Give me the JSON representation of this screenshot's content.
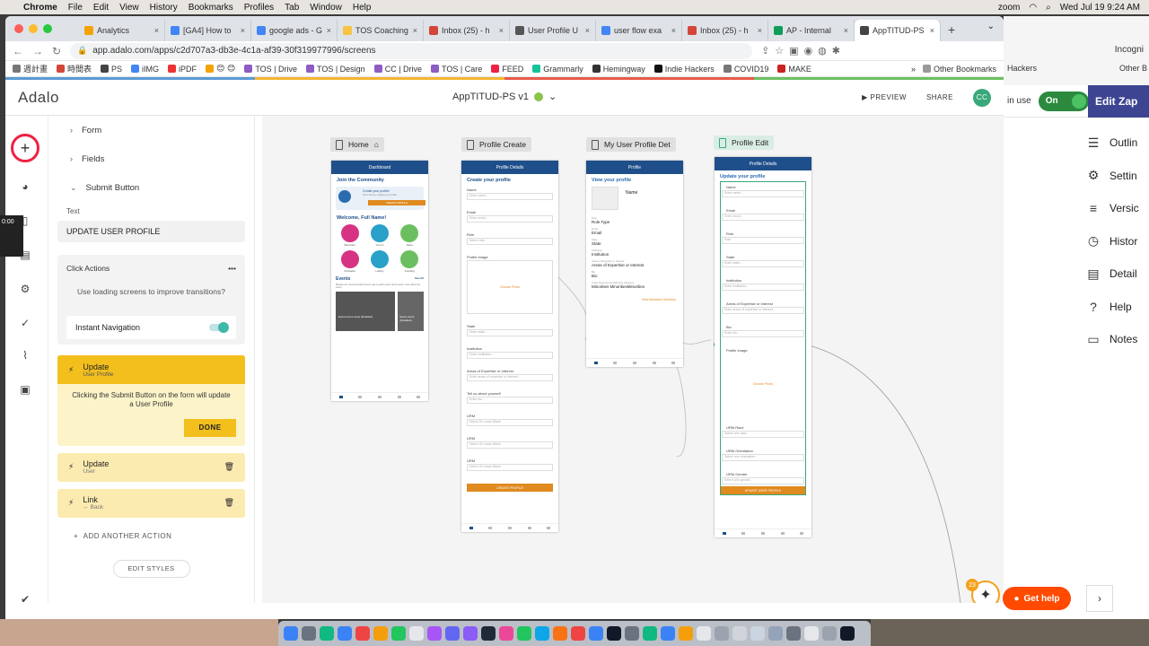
{
  "mac_menu": {
    "app": "Chrome",
    "items": [
      "File",
      "Edit",
      "View",
      "History",
      "Bookmarks",
      "Profiles",
      "Tab",
      "Window",
      "Help"
    ],
    "status_zoom": "zoom",
    "datetime": "Wed Jul 19  9:24 AM"
  },
  "browser": {
    "tabs": [
      {
        "title": "Analytics",
        "color": "#f4a300"
      },
      {
        "title": "[GA4] How to",
        "color": "#4285f4"
      },
      {
        "title": "google ads - G",
        "color": "#4285f4"
      },
      {
        "title": "TOS Coaching",
        "color": "#f6c342"
      },
      {
        "title": "Inbox (25) - h",
        "color": "#d44638"
      },
      {
        "title": "User Profile U",
        "color": "#555555"
      },
      {
        "title": "user flow exa",
        "color": "#4285f4"
      },
      {
        "title": "Inbox (25) - h",
        "color": "#d44638"
      },
      {
        "title": "AP - Internal",
        "color": "#0f9d58"
      },
      {
        "title": "AppTITUD-PS",
        "color": "#444444",
        "active": true
      }
    ],
    "url": "app.adalo.com/apps/c2d707a3-db3e-4c1a-af39-30f319977996/screens",
    "bookmarks": [
      "週計畫",
      "時間表",
      "PS",
      "iIMG",
      "iPDF",
      "😊 😊",
      "TOS | Drive",
      "TOS | Design",
      "CC | Drive",
      "TOS | Care",
      "FEED",
      "Grammarly",
      "Hemingway",
      "Indie Hackers",
      "COVID19",
      "MAKE"
    ],
    "bookmarks_more": "»",
    "other_bookmarks": "Other Bookmarks",
    "incognito": "Incogni",
    "other_bookmarks_2": "Other B",
    "hackers": "Hackers"
  },
  "adalo": {
    "logo": "Adalo",
    "app_name": "AppTITUD-PS v1",
    "preview": "PREVIEW",
    "share": "SHARE",
    "avatar": "CC"
  },
  "panel": {
    "rows": [
      "Form",
      "Fields",
      "Submit Button"
    ],
    "text_label": "Text",
    "text_value": "UPDATE USER PROFILE",
    "click_actions": "Click Actions",
    "tip": "Use loading screens to improve transitions?",
    "instant_nav": "Instant Navigation",
    "action_main": {
      "title": "Update",
      "sub": "User Profile",
      "desc": "Clicking the Submit Button on the form will update a User Profile",
      "done": "DONE"
    },
    "actions": [
      {
        "title": "Update",
        "sub": "User"
      },
      {
        "title": "Link",
        "sub": "← Back"
      }
    ],
    "add_action": "ADD ANOTHER ACTION",
    "edit_styles": "EDIT STYLES"
  },
  "canvas": {
    "screens": [
      {
        "label": "Home",
        "header": "Dashboard"
      },
      {
        "label": "Profile Create",
        "header": "Profile Details",
        "title": "Create your profile"
      },
      {
        "label": "My User Profile Det",
        "header": "Profile",
        "title": "View your profile"
      },
      {
        "label": "Profile Edit",
        "header": "Profile Details",
        "title": "Update your profile"
      }
    ],
    "home": {
      "join": "Join the Community",
      "create_title": "Create your profile!",
      "create_sub": "Don't miss by creating your profile!",
      "create_btn": "CREATE PROFILE",
      "welcome": "Welcome, Full Name!",
      "icons": [
        "Members",
        "Forum",
        "Store",
        "Podcasts",
        "Library",
        "Funding"
      ],
      "events": "Events",
      "see_all": "See All",
      "events_desc": "Browse our recommended events, tap on each event card to learn more about the event",
      "card1": "Event event name (Detailed)",
      "card2": "Event event (Detailed)"
    },
    "create_fields": [
      "Name",
      "Email",
      "Role",
      "Profile Image",
      "State",
      "Institution",
      "Areas of Expertise or Interest",
      "Tell us about yourself",
      "URM",
      "URM",
      "URM"
    ],
    "create_placeholders": [
      "Enter name...",
      "Enter email...",
      "Select role...",
      "Enter state...",
      "Enter institution...",
      "Enter areas of expertise or interest...",
      "Enter bio...",
      "Select Or Leave Blank",
      "Select Or Leave Blank",
      "Select Or Leave Blank"
    ],
    "choose_photo": "Choose Photo",
    "create_btn": "CREATE PROFILE",
    "view": {
      "name": "Name",
      "role_label": "Role",
      "role": "Role Type",
      "email_label": "Email",
      "email": "Email",
      "state_label": "State",
      "state": "State",
      "inst_label": "Institution",
      "inst": "Institution",
      "areas_label": "Areas of Expertise or Interest",
      "areas": "Areas of Expertise or Interest",
      "bio_label": "Bio",
      "bio": "Bio",
      "urm_label": "Under Represented Minority Category",
      "urm": "Minorities MinoritiesMinorities",
      "link": "View Members Directory"
    },
    "edit_fields": [
      "Name",
      "Email",
      "Role",
      "State",
      "Institution",
      "Areas of Expertise or Interest",
      "Bio",
      "Profile Image",
      "URM Race",
      "URM Orientation",
      "URM Gender"
    ],
    "edit_placeholders": [
      "Enter name...",
      "Enter email...",
      "Role",
      "Enter state...",
      "Enter institution...",
      "Enter areas of expertise or interest...",
      "Enter bio...",
      "Select urm race...",
      "Select urm orientation...",
      "Select urm gender..."
    ],
    "edit_btn": "UPDATE USER PROFILE",
    "badge": "23"
  },
  "zapier": {
    "in_use": "in use",
    "toggle": "On",
    "edit_zap": "Edit Zap",
    "items": [
      {
        "label": "Outlin",
        "icon": "☰"
      },
      {
        "label": "Settin",
        "icon": "⚙"
      },
      {
        "label": "Versic",
        "icon": "≡"
      },
      {
        "label": "Histor",
        "icon": "◷"
      },
      {
        "label": "Detail",
        "icon": "▤"
      },
      {
        "label": "Help",
        "icon": "?"
      },
      {
        "label": "Notes",
        "icon": "▭"
      }
    ],
    "get_help": "Get help"
  },
  "overlay": {
    "time": "0:00"
  }
}
